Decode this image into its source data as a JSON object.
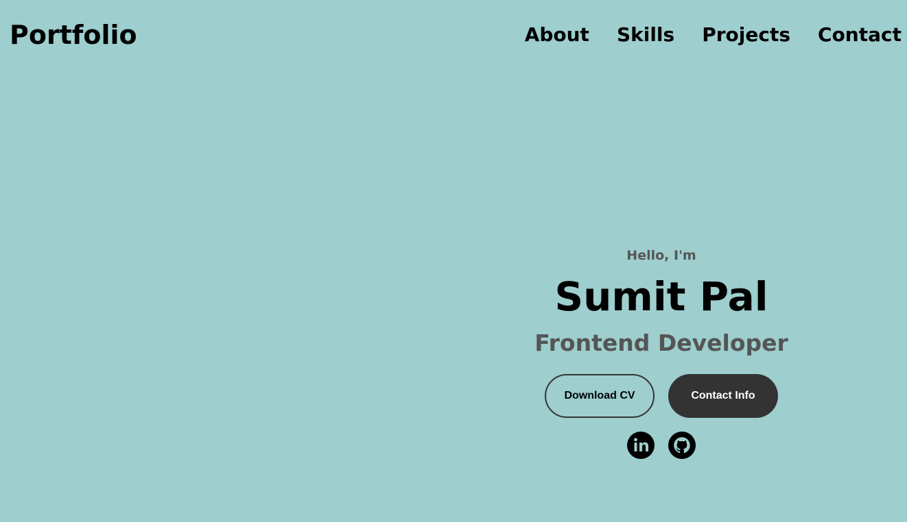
{
  "header": {
    "logo": "Portfolio",
    "nav": [
      {
        "label": "About"
      },
      {
        "label": "Skills"
      },
      {
        "label": "Projects"
      },
      {
        "label": "Contact"
      }
    ]
  },
  "hero": {
    "greeting": "Hello, I'm",
    "name": "Sumit Pal",
    "role": "Frontend Developer",
    "buttons": {
      "download": "Download CV",
      "contact": "Contact Info"
    },
    "socials": [
      {
        "icon": "linkedin-icon"
      },
      {
        "icon": "github-icon"
      }
    ]
  },
  "colors": {
    "background": "#9ecece",
    "dark": "#333333",
    "muted": "#555555"
  }
}
